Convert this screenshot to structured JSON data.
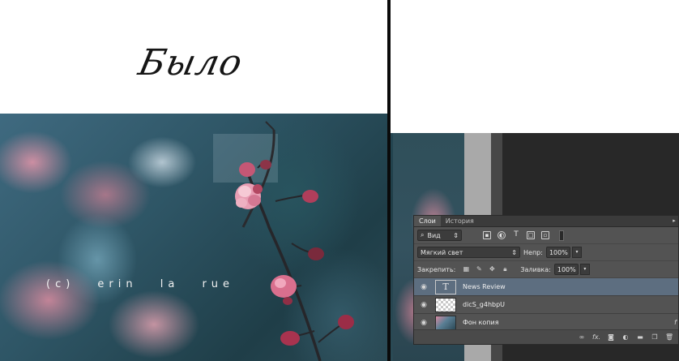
{
  "comparison": {
    "before_label": "Было"
  },
  "photo": {
    "watermark": "(c) erin la rue"
  },
  "layers_panel": {
    "tabs": [
      {
        "label": "Слои",
        "active": true
      },
      {
        "label": "История",
        "active": false
      }
    ],
    "filter": {
      "kind_label": "Вид",
      "icons": [
        "image-filter-icon",
        "adjustment-filter-icon",
        "text-filter-icon",
        "shape-filter-icon",
        "smart-object-filter-icon"
      ]
    },
    "blend": {
      "mode": "Мягкий свет",
      "opacity_label": "Непр:",
      "opacity_value": "100%"
    },
    "lock": {
      "label": "Закрепить:",
      "fill_label": "Заливка:",
      "fill_value": "100%"
    },
    "layers": [
      {
        "name": "News Review",
        "type": "text",
        "selected": true,
        "thumb_glyph": "T"
      },
      {
        "name": "dicS_g4hbpU",
        "type": "transparent",
        "selected": false
      },
      {
        "name": "Фон копия",
        "type": "photo",
        "selected": false,
        "fx": "f"
      }
    ],
    "footer_icons": [
      "link-icon",
      "fx-icon",
      "mask-icon",
      "adjustment-icon",
      "folder-icon",
      "new-layer-icon",
      "trash-icon"
    ],
    "footer_fx_label": "fx."
  },
  "colors": {
    "panel_bg": "#535353",
    "selected_layer": "#5d6e80",
    "workspace": "#282828"
  }
}
